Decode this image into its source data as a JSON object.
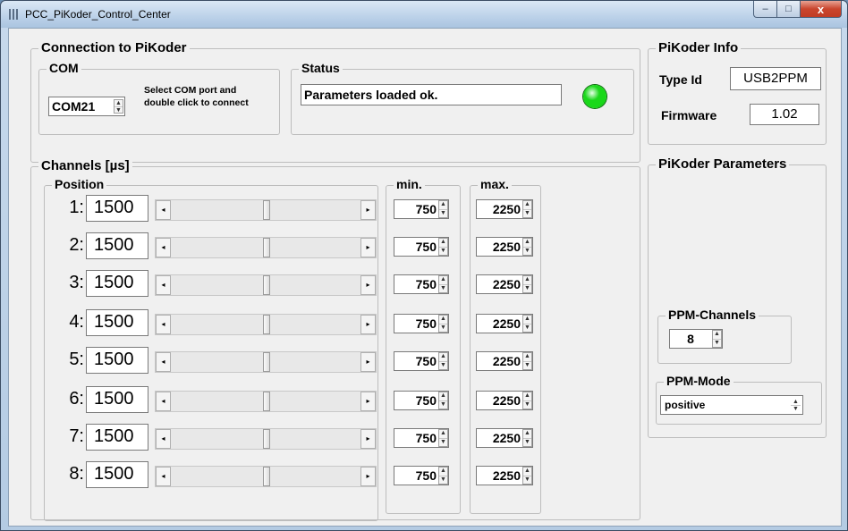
{
  "window": {
    "title": "PCC_PiKoder_Control_Center",
    "controls": {
      "minimize": "–",
      "maximize": "□",
      "close": "x"
    }
  },
  "connection": {
    "title": "Connection to PiKoder",
    "com": {
      "title": "COM",
      "value": "COM21",
      "hint_line1": "Select COM port and",
      "hint_line2": "double click to connect"
    },
    "status": {
      "title": "Status",
      "text": "Parameters loaded ok.",
      "indicator_color": "#1ad81a"
    }
  },
  "info": {
    "title": "PiKoder Info",
    "type_label": "Type Id",
    "type_value": "USB2PPM",
    "firmware_label": "Firmware",
    "firmware_value": "1.02"
  },
  "channels": {
    "title": "Channels [µs]",
    "position_title": "Position",
    "min_title": "min.",
    "max_title": "max.",
    "rows": [
      {
        "num": "1:",
        "value": "1500",
        "min": "750",
        "max": "2250",
        "level": 0.5
      },
      {
        "num": "2:",
        "value": "1500",
        "min": "750",
        "max": "2250",
        "level": 0.5
      },
      {
        "num": "3:",
        "value": "1500",
        "min": "750",
        "max": "2250",
        "level": 0.5
      },
      {
        "num": "4:",
        "value": "1500",
        "min": "750",
        "max": "2250",
        "level": 0.5
      },
      {
        "num": "5:",
        "value": "1500",
        "min": "750",
        "max": "2250",
        "level": 0.5
      },
      {
        "num": "6:",
        "value": "1500",
        "min": "750",
        "max": "2250",
        "level": 0.5
      },
      {
        "num": "7:",
        "value": "1500",
        "min": "750",
        "max": "2250",
        "level": 0.5
      },
      {
        "num": "8:",
        "value": "1500",
        "min": "750",
        "max": "2250",
        "level": 0.5
      }
    ]
  },
  "parameters": {
    "title": "PiKoder Parameters",
    "ppm_channels": {
      "title": "PPM-Channels",
      "value": "8"
    },
    "ppm_mode": {
      "title": "PPM-Mode",
      "value": "positive"
    }
  }
}
